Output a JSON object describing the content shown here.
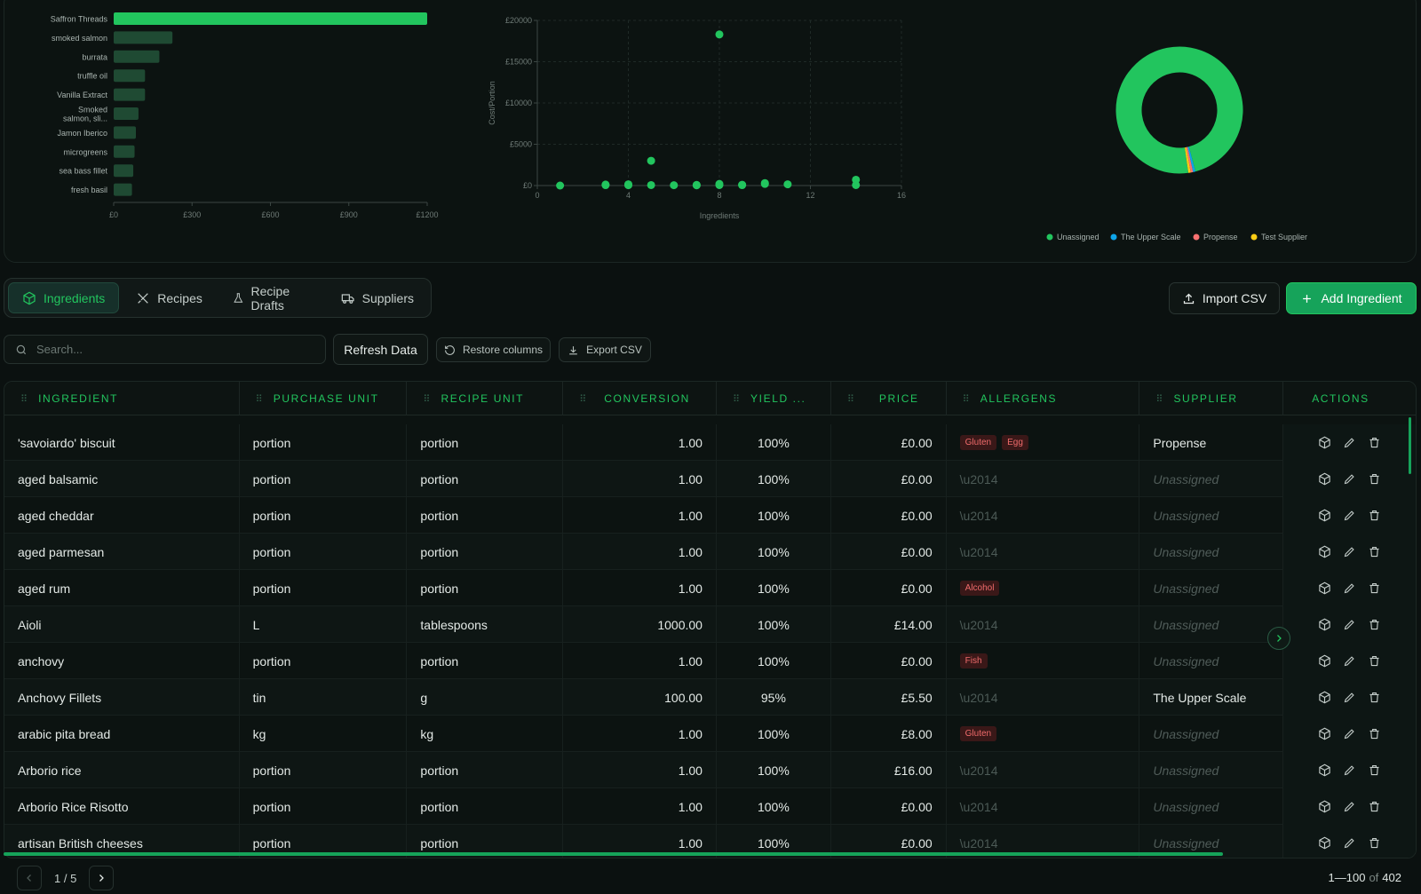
{
  "chart_data": [
    {
      "type": "bar",
      "orientation": "horizontal",
      "categories": [
        "Saffron Threads",
        "smoked salmon",
        "burrata",
        "truffle oil",
        "Vanilla Extract",
        "Smoked salmon, sli...",
        "Jamon Iberico",
        "microgreens",
        "sea bass fillet",
        "fresh basil"
      ],
      "values": [
        1200,
        225,
        175,
        120,
        120,
        95,
        85,
        80,
        75,
        70
      ],
      "xticks": [
        "£0",
        "£300",
        "£600",
        "£900",
        "£1200"
      ],
      "xlim": [
        0,
        1200
      ],
      "highlight_color": "#22c55e",
      "bar_color": "#1f4a33"
    },
    {
      "type": "scatter",
      "xlabel": "Ingredients",
      "ylabel": "Cost/Portion",
      "xlim": [
        0,
        16
      ],
      "ylim": [
        0,
        20000
      ],
      "xticks": [
        "0",
        "4",
        "8",
        "12",
        "16"
      ],
      "yticks": [
        "£0",
        "£5000",
        "£10000",
        "£15000",
        "£20000"
      ],
      "grid": true,
      "points": [
        [
          1,
          0
        ],
        [
          3,
          120
        ],
        [
          3,
          50
        ],
        [
          4,
          150
        ],
        [
          4,
          40
        ],
        [
          5,
          3000
        ],
        [
          5,
          60
        ],
        [
          6,
          40
        ],
        [
          7,
          80
        ],
        [
          7,
          30
        ],
        [
          8,
          18300
        ],
        [
          8,
          200
        ],
        [
          8,
          60
        ],
        [
          9,
          100
        ],
        [
          9,
          50
        ],
        [
          10,
          300
        ],
        [
          10,
          200
        ],
        [
          11,
          150
        ],
        [
          14,
          700
        ],
        [
          14,
          60
        ]
      ],
      "color": "#22c55e"
    },
    {
      "type": "pie",
      "donut": true,
      "slices": [
        {
          "label": "Unassigned",
          "value": 98,
          "color": "#22c55e"
        },
        {
          "label": "The Upper Scale",
          "value": 0.6,
          "color": "#0ea5e9"
        },
        {
          "label": "Propense",
          "value": 0.6,
          "color": "#f87171"
        },
        {
          "label": "Test Supplier",
          "value": 0.6,
          "color": "#facc15"
        }
      ],
      "legend_position": "bottom"
    }
  ],
  "tabs": [
    {
      "label": "Ingredients",
      "icon": "box-icon"
    },
    {
      "label": "Recipes",
      "icon": "utensils-icon"
    },
    {
      "label": "Recipe Drafts",
      "icon": "flask-icon"
    },
    {
      "label": "Suppliers",
      "icon": "truck-icon"
    }
  ],
  "toolbar": {
    "import_label": "Import CSV",
    "add_label": "Add Ingredient",
    "search_placeholder": "Search...",
    "refresh_label": "Refresh Data",
    "restore_label": "Restore columns",
    "export_label": "Export CSV"
  },
  "table": {
    "columns": [
      "INGREDIENT",
      "PURCHASE UNIT",
      "RECIPE UNIT",
      "CONVERSION",
      "YIELD ...",
      "PRICE",
      "ALLERGENS",
      "SUPPLIER",
      "ACTIONS"
    ],
    "rows": [
      {
        "name": "'savoiardo' biscuit",
        "purchase": "portion",
        "recipe": "portion",
        "conversion": "1.00",
        "yield": "100%",
        "price": "£0.00",
        "allergens": [
          "Gluten",
          "Egg"
        ],
        "supplier": "Propense"
      },
      {
        "name": "aged balsamic",
        "purchase": "portion",
        "recipe": "portion",
        "conversion": "1.00",
        "yield": "100%",
        "price": "£0.00",
        "allergens": [],
        "supplier": "Unassigned"
      },
      {
        "name": "aged cheddar",
        "purchase": "portion",
        "recipe": "portion",
        "conversion": "1.00",
        "yield": "100%",
        "price": "£0.00",
        "allergens": [],
        "supplier": "Unassigned"
      },
      {
        "name": "aged parmesan",
        "purchase": "portion",
        "recipe": "portion",
        "conversion": "1.00",
        "yield": "100%",
        "price": "£0.00",
        "allergens": [],
        "supplier": "Unassigned"
      },
      {
        "name": "aged rum",
        "purchase": "portion",
        "recipe": "portion",
        "conversion": "1.00",
        "yield": "100%",
        "price": "£0.00",
        "allergens": [
          "Alcohol"
        ],
        "supplier": "Unassigned"
      },
      {
        "name": "Aioli",
        "purchase": "L",
        "recipe": "tablespoons",
        "conversion": "1000.00",
        "yield": "100%",
        "price": "£14.00",
        "allergens": [],
        "supplier": "Unassigned"
      },
      {
        "name": "anchovy",
        "purchase": "portion",
        "recipe": "portion",
        "conversion": "1.00",
        "yield": "100%",
        "price": "£0.00",
        "allergens": [
          "Fish"
        ],
        "supplier": "Unassigned"
      },
      {
        "name": "Anchovy Fillets",
        "purchase": "tin",
        "recipe": "g",
        "conversion": "100.00",
        "yield": "95%",
        "price": "£5.50",
        "allergens": [],
        "supplier": "The Upper Scale"
      },
      {
        "name": "arabic pita bread",
        "purchase": "kg",
        "recipe": "kg",
        "conversion": "1.00",
        "yield": "100%",
        "price": "£8.00",
        "allergens": [
          "Gluten"
        ],
        "supplier": "Unassigned"
      },
      {
        "name": "Arborio rice",
        "purchase": "portion",
        "recipe": "portion",
        "conversion": "1.00",
        "yield": "100%",
        "price": "£16.00",
        "allergens": [],
        "supplier": "Unassigned"
      },
      {
        "name": "Arborio Rice Risotto",
        "purchase": "portion",
        "recipe": "portion",
        "conversion": "1.00",
        "yield": "100%",
        "price": "£0.00",
        "allergens": [],
        "supplier": "Unassigned"
      },
      {
        "name": "artisan British cheeses",
        "purchase": "portion",
        "recipe": "portion",
        "conversion": "1.00",
        "yield": "100%",
        "price": "£0.00",
        "allergens": [],
        "supplier": "Unassigned"
      }
    ],
    "empty_allergen": "\\u2014"
  },
  "pagination": {
    "page_label": "1 / 5",
    "range": "1—100",
    "of_label": "of",
    "total": "402"
  }
}
